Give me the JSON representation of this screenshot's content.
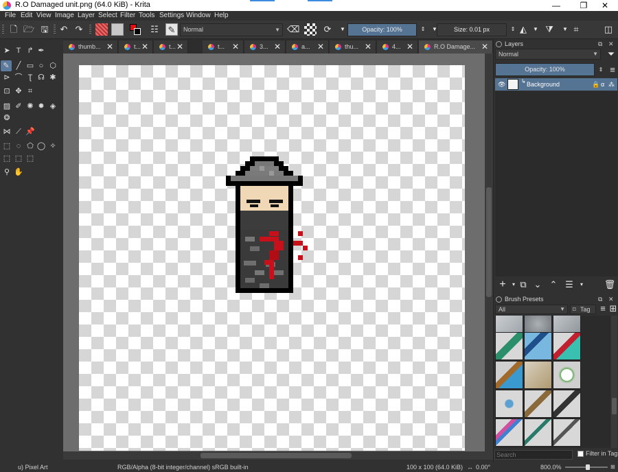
{
  "window": {
    "title": "R.O Damaged unit.png (64.0 KiB)  - Krita",
    "minimize": "—",
    "maximize": "❐",
    "close": "✕"
  },
  "menu": [
    "File",
    "Edit",
    "View",
    "Image",
    "Layer",
    "Select",
    "Filter",
    "Tools",
    "Settings",
    "Window",
    "Help"
  ],
  "toolbar": {
    "blend_mode": "Normal",
    "opacity": "Opacity: 100%",
    "size": "Size: 0.01 px"
  },
  "tabs": [
    {
      "label": "thumb...",
      "active": false
    },
    {
      "label": "t...",
      "active": false
    },
    {
      "label": "t...",
      "active": false
    },
    {
      "label": "t...",
      "active": false
    },
    {
      "label": "3...",
      "active": false
    },
    {
      "label": "a...",
      "active": false
    },
    {
      "label": "thu...",
      "active": false
    },
    {
      "label": "4...",
      "active": false
    },
    {
      "label": "R.O Damage...",
      "active": true
    }
  ],
  "layers": {
    "header": "Layers",
    "blend_mode": "Normal",
    "opacity": "Opacity:  100%",
    "rows": [
      {
        "name": "Background"
      }
    ]
  },
  "brush_presets": {
    "header": "Brush Presets",
    "filter": "All",
    "tag": "Tag",
    "search_placeholder": "Search",
    "filter_in_tag": "Filter in Tag"
  },
  "status": {
    "brush": "u) Pixel Art",
    "color_model": "RGB/Alpha (8-bit integer/channel)  sRGB built-in",
    "dimensions": "100 x 100 (64.0 KiB)",
    "rotation": "0.00°",
    "zoom": "800.0%"
  },
  "colors": {
    "accent": "#557392",
    "canvas_bg": "#6d6d6d",
    "ui_bg": "#313131",
    "blood": "#c8101a"
  }
}
